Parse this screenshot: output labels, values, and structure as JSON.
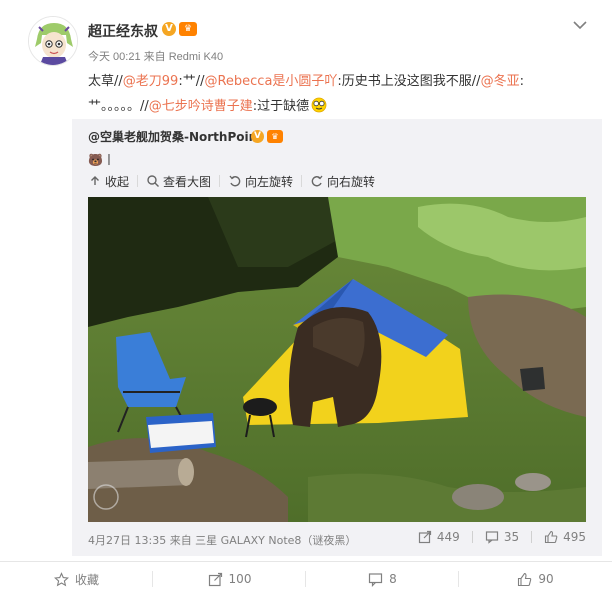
{
  "post": {
    "username": "超正经东叔",
    "meta": "今天 00:21 来自 Redmi K40",
    "content": {
      "p1": "太草//",
      "m1": "@老刀99",
      "p2": ":艹//",
      "m2": "@Rebecca是小圆子吖",
      "p3": ":历史书上没这图我不服//",
      "m3": "@冬亚",
      "p4": ":艹。。。。。//",
      "m4": "@七步吟诗曹子建",
      "p5": ":过于缺德"
    }
  },
  "repost": {
    "username": "@空巢老舰加贺桑-NorthPoint",
    "text": "🐻丨",
    "toolbar": {
      "collapse": "收起",
      "view_large": "查看大图",
      "rotate_left": "向左旋转",
      "rotate_right": "向右旋转"
    },
    "meta": "4月27日 13:35 来自 三星 GALAXY Note8（谜夜黑）",
    "reposts": "449",
    "comments": "35",
    "likes": "495"
  },
  "actions": {
    "favorite": "收藏",
    "repost": "100",
    "comment": "8",
    "like": "90"
  },
  "colors": {
    "mention": "#eb7350",
    "repost_bg": "#f2f2f5",
    "tent_blue": "#3c6ed0",
    "tent_yellow": "#f2d21c"
  }
}
